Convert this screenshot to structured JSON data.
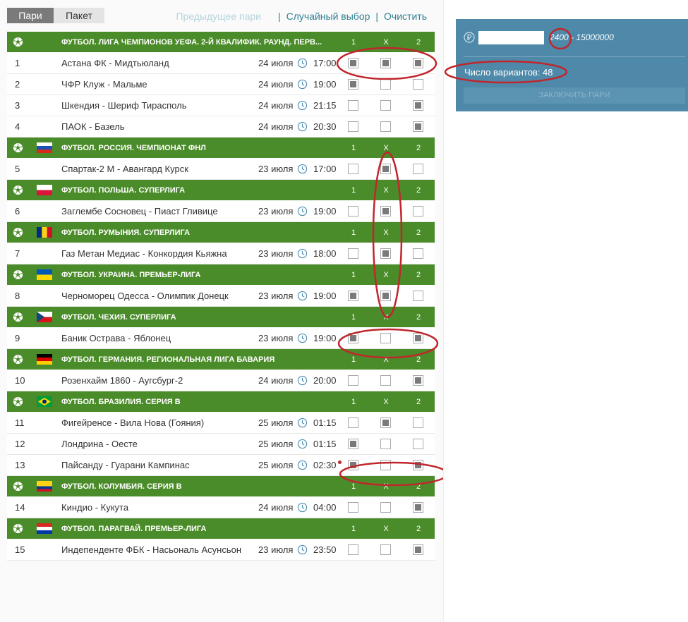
{
  "tabs": {
    "single": "Пари",
    "package": "Пакет"
  },
  "links": {
    "previous": "Предыдущее пари",
    "random": "Случайный выбор",
    "clear": "Очистить",
    "separator": "|"
  },
  "outcome_headers": {
    "home": "1",
    "draw": "X",
    "away": "2"
  },
  "sections": [
    {
      "league": "ФУТБОЛ. ЛИГА ЧЕМПИОНОВ УЕФА. 2-Й КВАЛИФИК. РАУНД. ПЕРВ...",
      "flag": "none",
      "matches": [
        {
          "num": "1",
          "teams": "Астана ФК - Мидтьюланд",
          "date": "24 июля",
          "time": "17:00",
          "picks": [
            true,
            true,
            true
          ]
        },
        {
          "num": "2",
          "teams": "ЧФР Клуж - Мальме",
          "date": "24 июля",
          "time": "19:00",
          "picks": [
            true,
            false,
            false
          ]
        },
        {
          "num": "3",
          "teams": "Шкендия - Шериф Тирасполь",
          "date": "24 июля",
          "time": "21:15",
          "picks": [
            false,
            false,
            true
          ]
        },
        {
          "num": "4",
          "teams": "ПАОК - Базель",
          "date": "24 июля",
          "time": "20:30",
          "picks": [
            false,
            false,
            true
          ]
        }
      ]
    },
    {
      "league": "ФУТБОЛ. РОССИЯ. ЧЕМПИОНАТ ФНЛ",
      "flag": "russia",
      "matches": [
        {
          "num": "5",
          "teams": "Спартак-2 М - Авангард Курск",
          "date": "23 июля",
          "time": "17:00",
          "picks": [
            false,
            true,
            false
          ]
        }
      ]
    },
    {
      "league": "ФУТБОЛ. ПОЛЬША. СУПЕРЛИГА",
      "flag": "poland",
      "matches": [
        {
          "num": "6",
          "teams": "Заглембе Сосновец - Пиаст Гливице",
          "date": "23 июля",
          "time": "19:00",
          "picks": [
            false,
            true,
            false
          ]
        }
      ]
    },
    {
      "league": "ФУТБОЛ. РУМЫНИЯ. СУПЕРЛИГА",
      "flag": "romania",
      "matches": [
        {
          "num": "7",
          "teams": "Газ Метан Медиас - Конкордия Кьяжна",
          "date": "23 июля",
          "time": "18:00",
          "picks": [
            false,
            true,
            false
          ]
        }
      ]
    },
    {
      "league": "ФУТБОЛ. УКРАИНА. ПРЕМЬЕР-ЛИГА",
      "flag": "ukraine",
      "matches": [
        {
          "num": "8",
          "teams": "Черноморец Одесса - Олимпик Донецк",
          "date": "23 июля",
          "time": "19:00",
          "picks": [
            true,
            true,
            false
          ]
        }
      ]
    },
    {
      "league": "ФУТБОЛ. ЧЕХИЯ. СУПЕРЛИГА",
      "flag": "czech",
      "matches": [
        {
          "num": "9",
          "teams": "Баник Острава - Яблонец",
          "date": "23 июля",
          "time": "19:00",
          "picks": [
            true,
            false,
            true
          ]
        }
      ]
    },
    {
      "league": "ФУТБОЛ. ГЕРМАНИЯ. РЕГИОНАЛЬНАЯ ЛИГА БАВАРИЯ",
      "flag": "germany",
      "matches": [
        {
          "num": "10",
          "teams": "Розенхайм 1860 - Аугсбург-2",
          "date": "24 июля",
          "time": "20:00",
          "picks": [
            false,
            false,
            true
          ]
        }
      ]
    },
    {
      "league": "ФУТБОЛ. БРАЗИЛИЯ. СЕРИЯ B",
      "flag": "brazil",
      "matches": [
        {
          "num": "11",
          "teams": "Фигейренсе - Вила Нова (Гояния)",
          "date": "25 июля",
          "time": "01:15",
          "picks": [
            false,
            true,
            false
          ]
        },
        {
          "num": "12",
          "teams": "Лондрина - Оесте",
          "date": "25 июля",
          "time": "01:15",
          "picks": [
            true,
            false,
            false
          ]
        },
        {
          "num": "13",
          "teams": "Пайсанду - Гуарани Кампинас",
          "date": "25 июля",
          "time": "02:30",
          "picks": [
            true,
            false,
            true
          ],
          "live_dot": true
        }
      ]
    },
    {
      "league": "ФУТБОЛ. КОЛУМБИЯ. СЕРИЯ B",
      "flag": "colombia",
      "matches": [
        {
          "num": "14",
          "teams": "Киндио - Кукута",
          "date": "24 июля",
          "time": "04:00",
          "picks": [
            false,
            false,
            true
          ]
        }
      ]
    },
    {
      "league": "ФУТБОЛ. ПАРАГВАЙ. ПРЕМЬЕР-ЛИГА",
      "flag": "paraguay",
      "matches": [
        {
          "num": "15",
          "teams": "Индепенденте ФБК - Насьональ Асунсьон",
          "date": "23 июля",
          "time": "23:50",
          "picks": [
            false,
            false,
            true
          ]
        }
      ]
    }
  ],
  "slip": {
    "stake_value": "",
    "range_min": "2400",
    "range_dash": "-",
    "range_max": "15000000",
    "variants": "Число вариантов: 48",
    "place_button": "ЗАКЛЮЧИТЬ ПАРИ"
  },
  "colors": {
    "league_bar": "#4b8c2a",
    "slip_panel": "#4e89a9",
    "annotation": "#c0262c",
    "link": "#2f7f92"
  },
  "icons": {
    "sport": "soccer-ball-icon",
    "time": "clock-icon",
    "currency": "ruble-icon"
  }
}
